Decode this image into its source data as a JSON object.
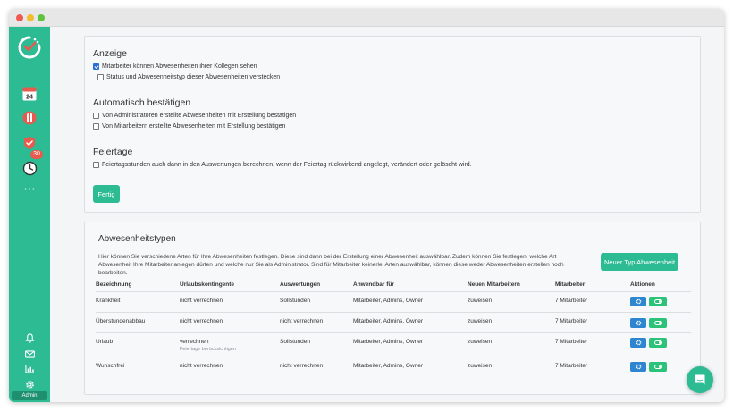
{
  "sidebar": {
    "calendar_month": "Mon",
    "calendar_day": "24",
    "overtime_badge": "30",
    "more": "• • •",
    "admin_label": "Admin"
  },
  "display": {
    "heading": "Anzeige",
    "option1": "Mitarbeiter können Abwesenheiten ihrer Kollegen sehen",
    "option1_checked": true,
    "option2": "Status und Abwesenheitstyp dieser Abwesenheiten verstecken",
    "option2_checked": false
  },
  "auto_confirm": {
    "heading": "Automatisch bestätigen",
    "option1": "Von Administratoren erstellte Abwesenheiten mit Erstellung bestätigen",
    "option2": "Von Mitarbeitern erstellte Abwesenheiten mit Erstellung bestätigen"
  },
  "holidays": {
    "heading": "Feiertage",
    "option1": "Feiertagsstunden auch dann in den Auswertungen berechnen, wenn der Feiertag rückwirkend angelegt, verändert oder gelöscht wird."
  },
  "done_button": "Fertig",
  "absence_types": {
    "title": "Abwesenheitstypen",
    "description": "Hier können Sie verschiedene Arten für Ihre Abwesenheiten festlegen. Diese sind dann bei der Erstellung einer Abwesenheit auswählbar. Zudem können Sie festlegen, welche Art Abwesenheit Ihre Mitarbeiter anlegen dürfen und welche nur Sie als Administrator. Sind für Mitarbeiter keinerlei Arten auswählbar, können diese weder Abwesenheiten erstellen noch bearbeiten.",
    "new_button": "Neuer Typ Abwesenheit",
    "columns": [
      "Bezeichnung",
      "Urlaubskontingente",
      "Auswertungen",
      "Anwendbar für",
      "Neuen Mitarbeitern",
      "Mitarbeiter",
      "Aktionen"
    ],
    "rows": [
      {
        "name": "Krankheit",
        "quota": "nicht verrechnen",
        "quota_note": "",
        "reports": "Sollstunden",
        "applies": "Mitarbeiter, Admins, Owner",
        "new_employees": "zuweisen",
        "employees": "7 Mitarbeiter"
      },
      {
        "name": "Überstundenabbau",
        "quota": "nicht verrechnen",
        "quota_note": "",
        "reports": "nicht verrechnen",
        "applies": "Mitarbeiter, Admins, Owner",
        "new_employees": "zuweisen",
        "employees": "7 Mitarbeiter"
      },
      {
        "name": "Urlaub",
        "quota": "verrechnen",
        "quota_note": "Feiertage berücksichtigen",
        "reports": "Sollstunden",
        "applies": "Mitarbeiter, Admins, Owner",
        "new_employees": "zuweisen",
        "employees": "7 Mitarbeiter"
      },
      {
        "name": "Wunschfrei",
        "quota": "nicht verrechnen",
        "quota_note": "",
        "reports": "nicht verrechnen",
        "applies": "Mitarbeiter, Admins, Owner",
        "new_employees": "zuweisen",
        "employees": "7 Mitarbeiter"
      }
    ]
  },
  "colors": {
    "brand_green": "#2dbb94",
    "action_blue": "#2f86d0",
    "toggle_green": "#2dc27a",
    "badge_red": "#e95a4c"
  },
  "icons": [
    "logo-clock-icon",
    "calendar-icon",
    "vacation-icon",
    "shield-icon",
    "overtime-clock-icon",
    "more-icon",
    "bell-icon",
    "mail-icon",
    "chart-icon",
    "gear-icon",
    "gear-action-icon",
    "toggle-icon",
    "chat-icon"
  ]
}
